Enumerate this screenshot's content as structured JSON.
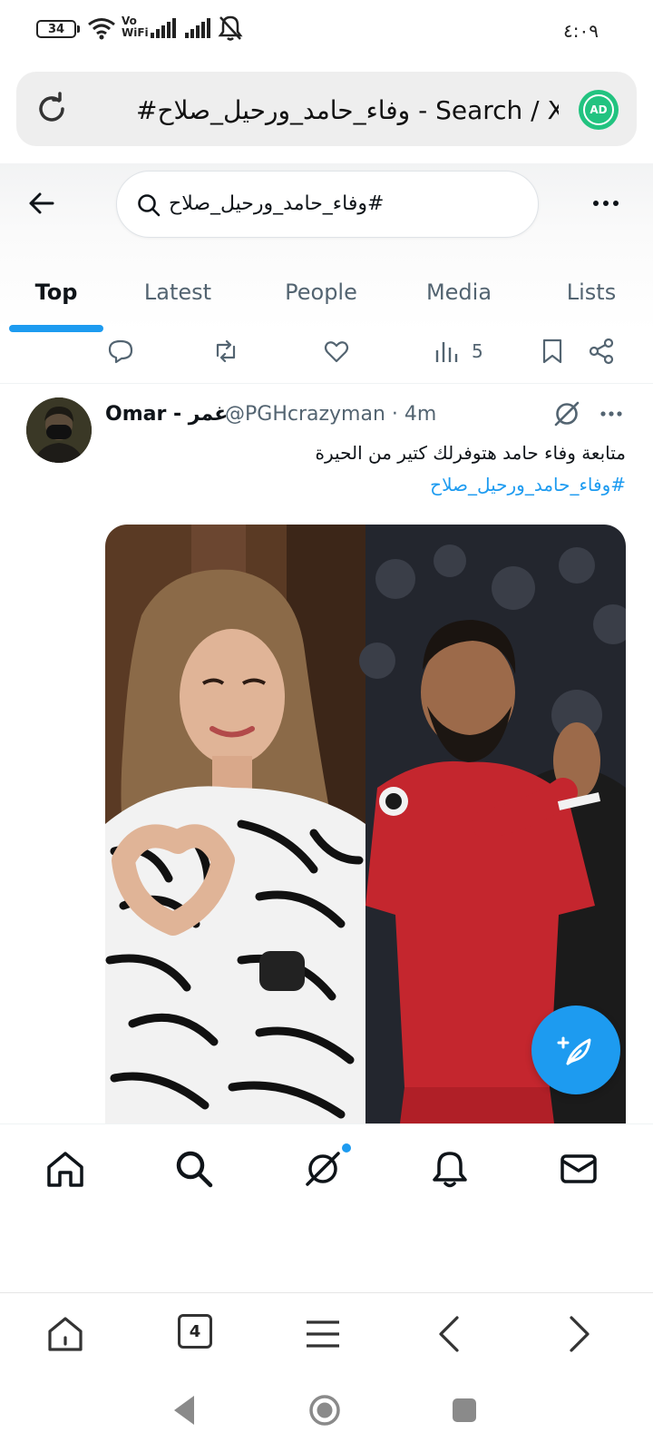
{
  "status_bar": {
    "battery": "34",
    "network_label": "Vo\nWiFi",
    "time": "٤:٠٩"
  },
  "browser": {
    "url_title": "#وفاء_حامد_ورحيل_صلاح - Search / X",
    "ad_badge": "AD",
    "tab_count": "4"
  },
  "search": {
    "query": "#وفاء_حامد_ورحيل_صلاح"
  },
  "tabs": [
    {
      "label": "Top",
      "active": true
    },
    {
      "label": "Latest",
      "active": false
    },
    {
      "label": "People",
      "active": false
    },
    {
      "label": "Media",
      "active": false
    },
    {
      "label": "Lists",
      "active": false
    }
  ],
  "previous_post": {
    "views": "5"
  },
  "post": {
    "display_name": "Omar - غمر",
    "handle_time": "@PGHcrazyman · 4m",
    "text": "متابعة وفاء حامد هتوفرلك كتير من الحيرة",
    "hashtag": "#وفاء_حامد_ورحيل_صلاح"
  },
  "colors": {
    "accent": "#1d9bf0",
    "ad_badge": "#22c380",
    "text_primary": "#0f1419",
    "text_secondary": "#536471"
  },
  "icons": {
    "nav": [
      "home-icon",
      "search-icon",
      "grok-icon",
      "notifications-icon",
      "messages-icon"
    ],
    "browser": [
      "browser-home-icon",
      "tabs-icon",
      "menu-icon",
      "back-icon",
      "forward-icon"
    ]
  }
}
